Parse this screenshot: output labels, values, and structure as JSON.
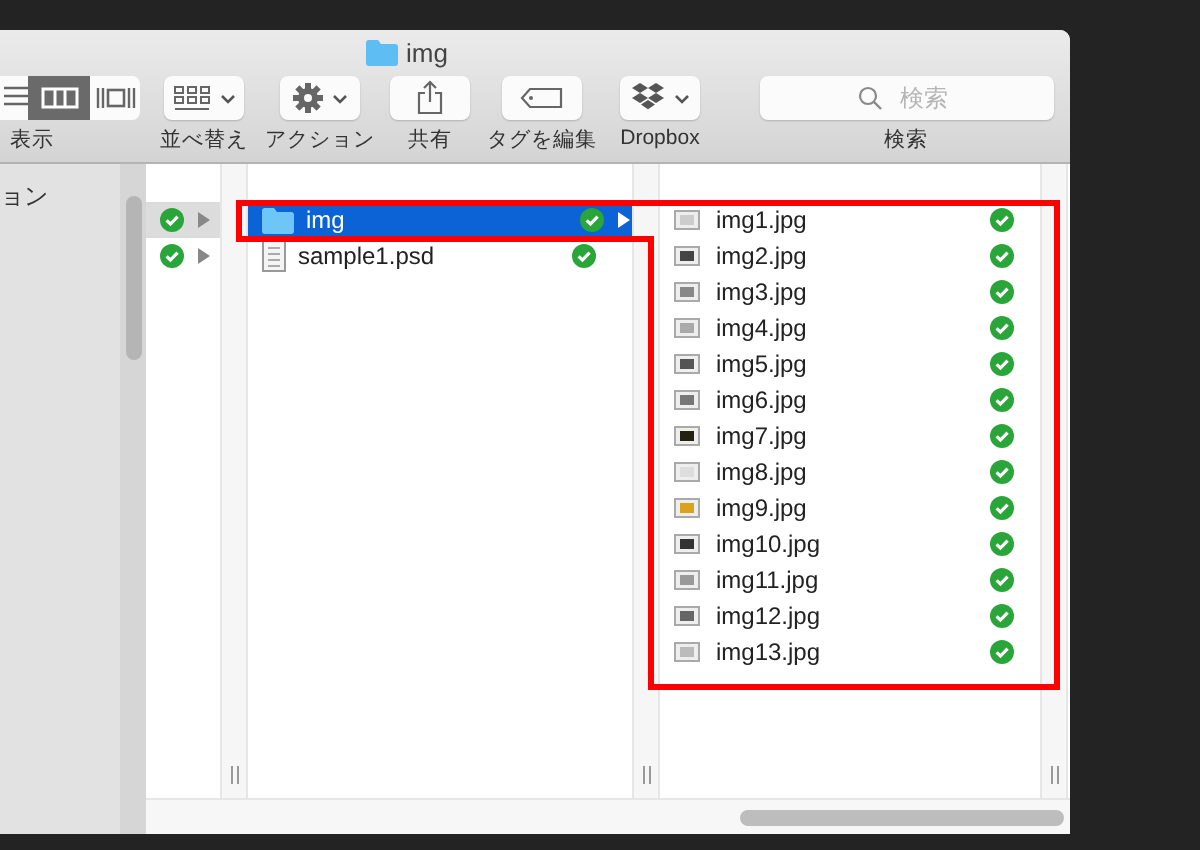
{
  "window": {
    "title": "img"
  },
  "toolbar": {
    "view_label": "表示",
    "view_modes": [
      {
        "kind": "list",
        "selected": false
      },
      {
        "kind": "columns",
        "selected": true
      },
      {
        "kind": "coverflow",
        "selected": false
      }
    ],
    "buttons": [
      {
        "kind": "sort",
        "label": "並べ替え",
        "menu": true
      },
      {
        "kind": "action",
        "label": "アクション",
        "menu": true
      },
      {
        "kind": "share",
        "label": "共有",
        "menu": false
      },
      {
        "kind": "tag",
        "label": "タグを編集",
        "menu": false
      },
      {
        "kind": "dropbox",
        "label": "Dropbox",
        "menu": true
      }
    ],
    "search": {
      "placeholder": "検索",
      "label": "検索"
    }
  },
  "sidebar": {
    "items": [
      {
        "label": "ョン"
      }
    ]
  },
  "columns": [
    {
      "rows": [
        {
          "selected": true,
          "synced": true,
          "has_children": true
        },
        {
          "selected": false,
          "synced": true,
          "has_children": true
        }
      ]
    },
    {
      "rows": [
        {
          "name": "img",
          "kind": "folder",
          "selected": true,
          "synced": true,
          "has_children": true
        },
        {
          "name": "sample1.psd",
          "kind": "document",
          "selected": false,
          "synced": true,
          "has_children": false
        }
      ]
    },
    {
      "rows": [
        {
          "name": "img1.jpg",
          "kind": "image",
          "selected": false,
          "synced": true,
          "has_children": false
        },
        {
          "name": "img2.jpg",
          "kind": "image",
          "selected": false,
          "synced": true,
          "has_children": false
        },
        {
          "name": "img3.jpg",
          "kind": "image",
          "selected": false,
          "synced": true,
          "has_children": false
        },
        {
          "name": "img4.jpg",
          "kind": "image",
          "selected": false,
          "synced": true,
          "has_children": false
        },
        {
          "name": "img5.jpg",
          "kind": "image",
          "selected": false,
          "synced": true,
          "has_children": false
        },
        {
          "name": "img6.jpg",
          "kind": "image",
          "selected": false,
          "synced": true,
          "has_children": false
        },
        {
          "name": "img7.jpg",
          "kind": "image",
          "selected": false,
          "synced": true,
          "has_children": false
        },
        {
          "name": "img8.jpg",
          "kind": "image",
          "selected": false,
          "synced": true,
          "has_children": false
        },
        {
          "name": "img9.jpg",
          "kind": "image",
          "selected": false,
          "synced": true,
          "has_children": false
        },
        {
          "name": "img10.jpg",
          "kind": "image",
          "selected": false,
          "synced": true,
          "has_children": false
        },
        {
          "name": "img11.jpg",
          "kind": "image",
          "selected": false,
          "synced": true,
          "has_children": false
        },
        {
          "name": "img12.jpg",
          "kind": "image",
          "selected": false,
          "synced": true,
          "has_children": false
        },
        {
          "name": "img13.jpg",
          "kind": "image",
          "selected": false,
          "synced": true,
          "has_children": false
        }
      ]
    }
  ]
}
